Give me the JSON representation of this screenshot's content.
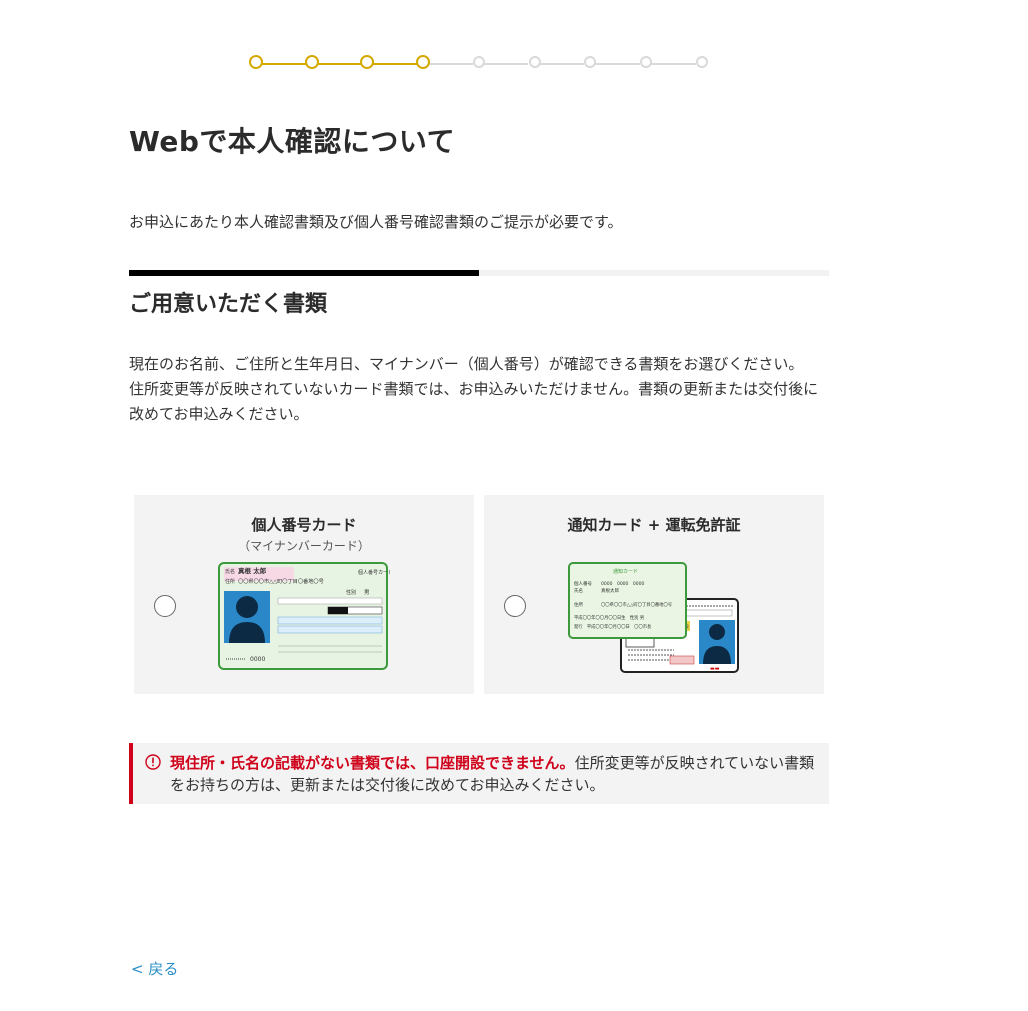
{
  "stepper": {
    "total_steps": 9,
    "completed_steps": 4,
    "active_color": "#d4a900",
    "inactive_color": "#d9d9d9"
  },
  "page_title": "Webで本人確認について",
  "lead_text": "お申込にあたり本人確認書類及び個人番号確認書類のご提示が必要です。",
  "section": {
    "title": "ご用意いただく書類",
    "desc_line1": "現在のお名前、ご住所と生年月日、マイナンバー（個人番号）が確認できる書類をお選びください。",
    "desc_line2": "住所変更等が反映されていないカード書類では、お申込みいただけません。書類の更新または交付後に改めてお申込みください。"
  },
  "options": [
    {
      "label": "個人番号カード",
      "sublabel": "（マイナンバーカード）",
      "selected": false,
      "card": {
        "name_label": "氏名",
        "name_value": "真根 太郎",
        "address_label": "住所",
        "address_value": "〇〇県〇〇市△△町〇丁目〇番地〇号",
        "card_type": "個人番号カード",
        "sex_label": "性別",
        "sex_value": "男",
        "number": "0000"
      }
    },
    {
      "label": "通知カード + 運転免許証",
      "sublabel": "",
      "selected": false,
      "card": {
        "notice_title": "通知カード",
        "notice_number_label": "個人番号",
        "notice_number_value": "0000　0000　0000",
        "notice_name_label": "氏名",
        "notice_name_value": "真根太郎",
        "notice_address_label": "住所",
        "notice_address_value": "〇〇県〇〇市△△町〇丁目〇番地〇号",
        "notice_birth": "平成〇〇年〇〇月〇〇日生　性別 男",
        "notice_issue": "発行　平成〇〇年〇月〇〇日　〇〇市長",
        "license_badge": "優良"
      }
    }
  ],
  "alert": {
    "strong_text": "現住所・氏名の記載がない書類では、口座開設できません。",
    "text": "住所変更等が反映されていない書類をお持ちの方は、更新または交付後に改めてお申込みください。",
    "color": "#d0021b"
  },
  "back_link": "< 戻る"
}
